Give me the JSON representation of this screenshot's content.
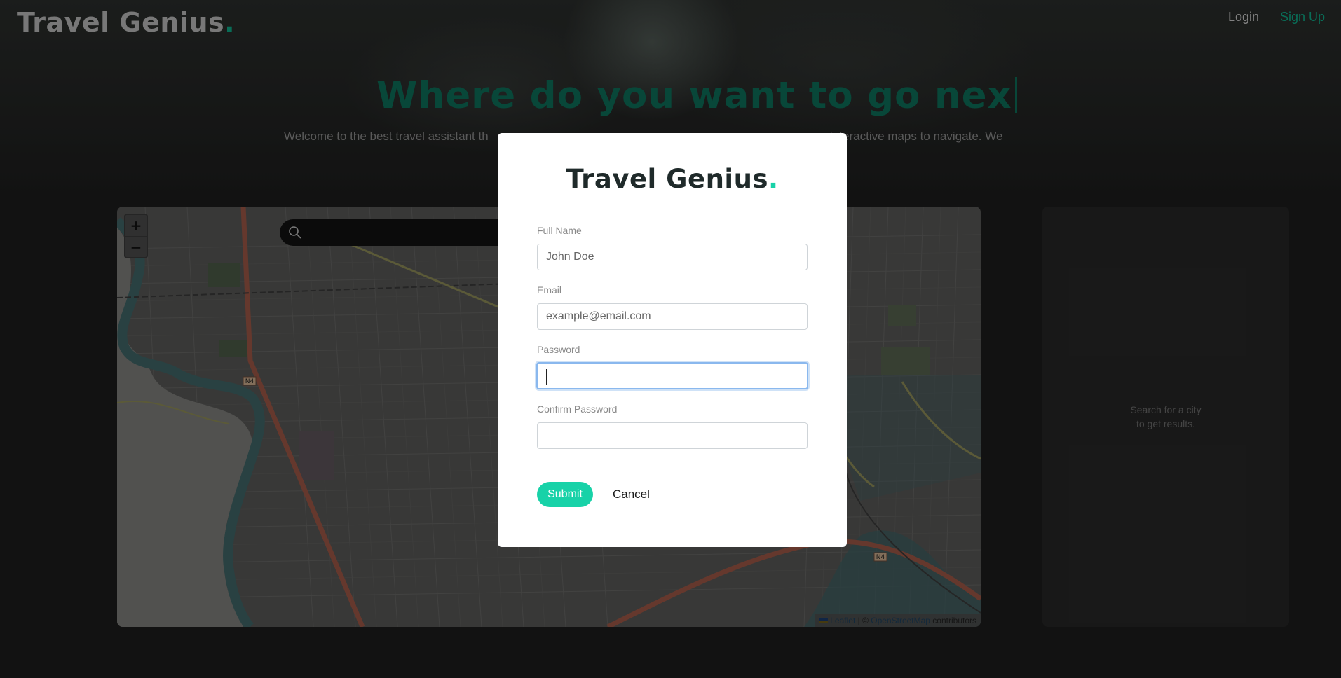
{
  "header": {
    "logo_text": "Travel Genius",
    "logo_dot": ".",
    "nav": {
      "login": "Login",
      "signup": "Sign Up"
    }
  },
  "hero": {
    "title": "Where do you want to go nex",
    "subtitle": "Welcome to the best travel assistant th                                                                                              e our interactive maps to navigate. We"
  },
  "map": {
    "zoom_in": "+",
    "zoom_out": "−",
    "search_placeholder": "",
    "attribution": {
      "leaflet": "Leaflet",
      "separator": " | © ",
      "osm": "OpenStreetMap",
      "suffix": " contributors"
    },
    "road_labels": [
      "N4",
      "N4"
    ]
  },
  "results": {
    "empty_line1": "Search for a city",
    "empty_line2": "to get results."
  },
  "modal": {
    "logo_text": "Travel Genius",
    "logo_dot": ".",
    "fields": {
      "full_name": {
        "label": "Full Name",
        "placeholder": "John Doe"
      },
      "email": {
        "label": "Email",
        "placeholder": "example@email.com"
      },
      "password": {
        "label": "Password",
        "placeholder": ""
      },
      "confirm_password": {
        "label": "Confirm Password",
        "placeholder": ""
      }
    },
    "submit": "Submit",
    "cancel": "Cancel"
  },
  "colors": {
    "accent": "#18d2a8",
    "accent_dark": "#0d6e58",
    "background": "#1c1c1c",
    "focus_ring": "#8ab8ee"
  }
}
